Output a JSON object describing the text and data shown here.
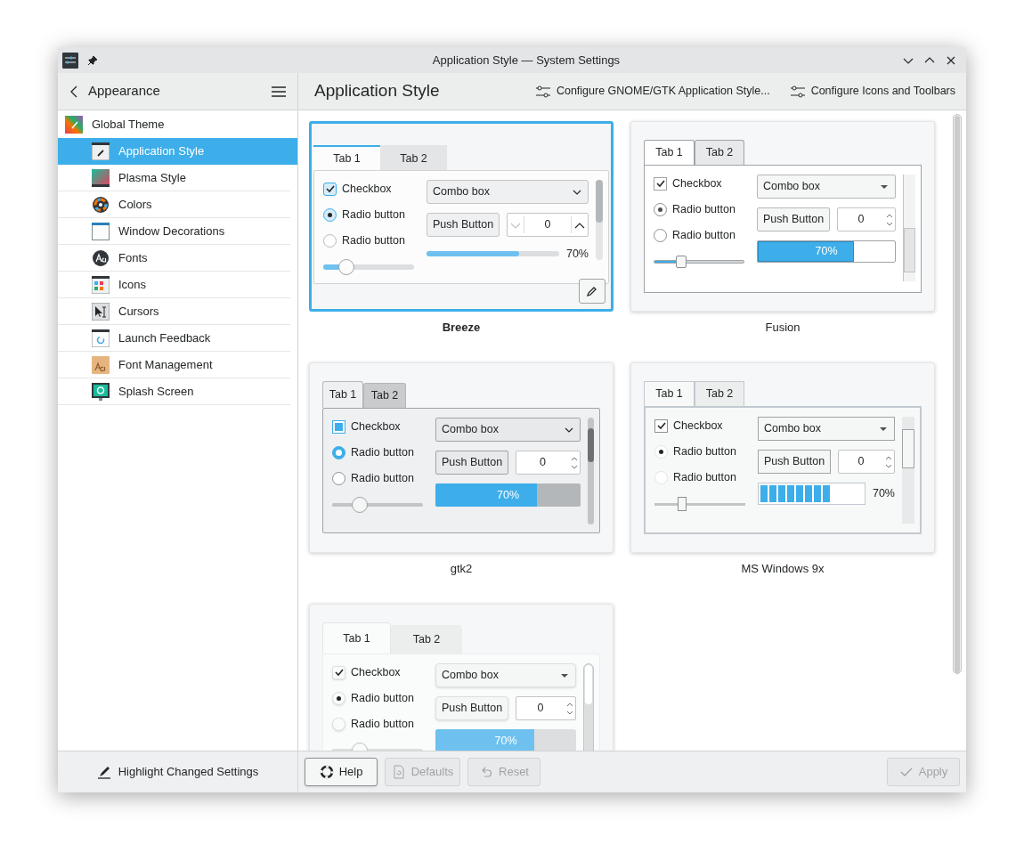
{
  "window": {
    "title": "Application Style — System Settings"
  },
  "sidebar": {
    "back_label": "Appearance",
    "items": [
      {
        "label": "Global Theme",
        "selected": false,
        "children": [
          {
            "label": "Application Style",
            "selected": true
          },
          {
            "label": "Plasma Style",
            "selected": false
          },
          {
            "label": "Colors",
            "selected": false
          },
          {
            "label": "Window Decorations",
            "selected": false
          },
          {
            "label": "Fonts",
            "selected": false
          },
          {
            "label": "Icons",
            "selected": false
          },
          {
            "label": "Cursors",
            "selected": false
          },
          {
            "label": "Launch Feedback",
            "selected": false
          },
          {
            "label": "Font Management",
            "selected": false
          },
          {
            "label": "Splash Screen",
            "selected": false
          }
        ]
      }
    ],
    "highlight_label": "Highlight Changed Settings"
  },
  "page": {
    "title": "Application Style",
    "actions": [
      "Configure GNOME/GTK Application Style...",
      "Configure Icons and Toolbars"
    ]
  },
  "styles": [
    {
      "kind": "breeze",
      "name": "Breeze",
      "selected": true,
      "configurable": true,
      "preview": {
        "tabs": [
          {
            "label": "Tab 1",
            "selected": true
          },
          {
            "label": "Tab 2",
            "selected": false
          }
        ],
        "checkbox": {
          "label": "Checkbox",
          "checked": true
        },
        "radios": [
          {
            "label": "Radio button",
            "selected": true
          },
          {
            "label": "Radio button",
            "selected": false
          }
        ],
        "combo": "Combo box",
        "button": "Push Button",
        "spin": "0",
        "slider": {
          "level": 0.25
        },
        "progress": {
          "level": 0.7,
          "reading": "70%"
        }
      }
    },
    {
      "kind": "fusion",
      "name": "Fusion",
      "selected": false,
      "configurable": false,
      "preview": {
        "tabs": [
          {
            "label": "Tab 1",
            "selected": true
          },
          {
            "label": "Tab 2",
            "selected": false
          }
        ],
        "checkbox": {
          "label": "Checkbox",
          "checked": true
        },
        "radios": [
          {
            "label": "Radio button",
            "selected": true
          },
          {
            "label": "Radio button",
            "selected": false
          }
        ],
        "combo": "Combo box",
        "button": "Push Button",
        "spin": "0",
        "slider": {
          "level": 0.3
        },
        "progress": {
          "level": 0.7,
          "reading": "70%"
        }
      }
    },
    {
      "kind": "gtk2",
      "name": "gtk2",
      "selected": false,
      "configurable": false,
      "preview": {
        "tabs": [
          {
            "label": "Tab 1",
            "selected": true
          },
          {
            "label": "Tab 2",
            "selected": false
          }
        ],
        "checkbox": {
          "label": "Checkbox",
          "checked": true
        },
        "radios": [
          {
            "label": "Radio button",
            "selected": true
          },
          {
            "label": "Radio button",
            "selected": false
          }
        ],
        "combo": "Combo box",
        "button": "Push Button",
        "spin": "0",
        "slider": {
          "level": 0.3
        },
        "progress": {
          "level": 0.7,
          "reading": "70%"
        }
      }
    },
    {
      "kind": "windows9x",
      "name": "MS Windows 9x",
      "selected": false,
      "configurable": false,
      "preview": {
        "tabs": [
          {
            "label": "Tab 1",
            "selected": true
          },
          {
            "label": "Tab 2",
            "selected": false
          }
        ],
        "checkbox": {
          "label": "Checkbox",
          "checked": true
        },
        "radios": [
          {
            "label": "Radio button",
            "selected": true
          },
          {
            "label": "Radio button",
            "selected": false
          }
        ],
        "combo": "Combo box",
        "button": "Push Button",
        "spin": "0",
        "slider": {
          "level": 0.3
        },
        "progress": {
          "level": 0.7,
          "reading": "70%"
        }
      }
    },
    {
      "kind": "oxygen",
      "selected": false,
      "configurable": false,
      "preview": {
        "tabs": [
          {
            "label": "Tab 1",
            "selected": true
          },
          {
            "label": "Tab 2",
            "selected": false
          }
        ],
        "checkbox": {
          "label": "Checkbox",
          "checked": true
        },
        "radios": [
          {
            "label": "Radio button",
            "selected": true
          },
          {
            "label": "Radio button",
            "selected": false
          }
        ],
        "combo": "Combo box",
        "button": "Push Button",
        "spin": "0",
        "slider": {
          "level": 0.3
        },
        "progress": {
          "level": 0.7,
          "reading": "70%"
        }
      }
    }
  ],
  "footer": {
    "buttons": [
      {
        "kind": "help",
        "label": "Help",
        "disabled": false
      },
      {
        "kind": "defaults",
        "label": "Defaults",
        "disabled": true
      },
      {
        "kind": "reset",
        "label": "Reset",
        "disabled": true
      },
      {
        "kind": "apply",
        "label": "Apply",
        "disabled": true
      }
    ]
  }
}
